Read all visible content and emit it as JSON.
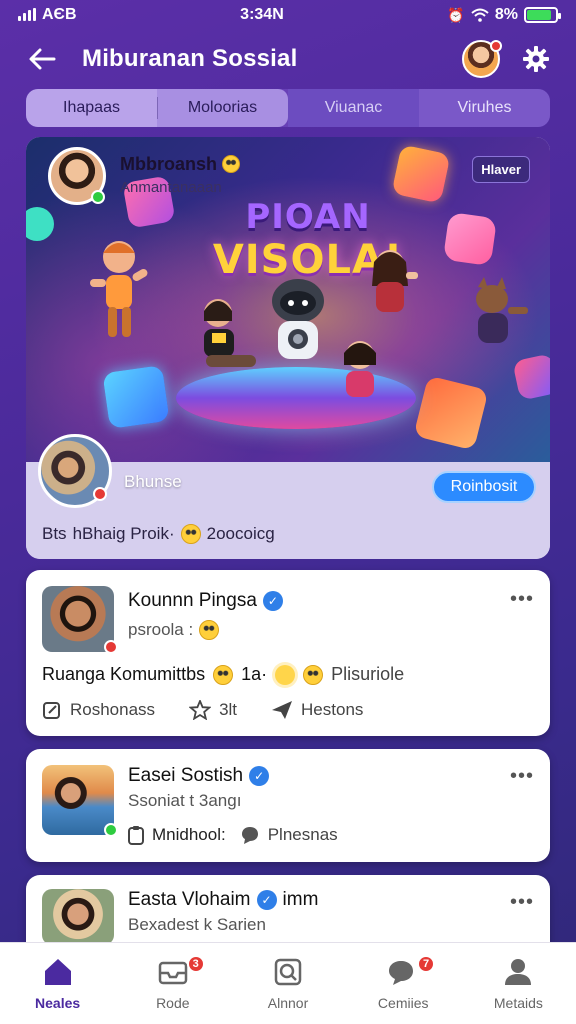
{
  "status_bar": {
    "carrier": "AЄB",
    "time": "3:34N",
    "battery": "8%",
    "battery_fraction": 0.85
  },
  "header": {
    "title": "Miburanan Sossial"
  },
  "tabs": [
    {
      "label": "Ihapaas"
    },
    {
      "label": "Moloorias"
    },
    {
      "label": "Viuanac"
    },
    {
      "label": "Viruhes"
    }
  ],
  "feature": {
    "author_name": "Mbbroansh",
    "author_sub": "Anmantanaaan",
    "tag": "Hlaver",
    "banner_line1": "PIOAN",
    "banner_line2": "VISOLA!",
    "group_name": "Bhunse",
    "join_label": "Roinbosit",
    "meta_left": "Bts",
    "meta_mid": "hBhaig Proik·",
    "meta_right": "2oocoicg"
  },
  "posts": [
    {
      "name": "Kounnn Pingsa",
      "sub": "psroola :",
      "line_text": "Ruanga Komumittbs",
      "line_extra": "1a·",
      "line_tail": "Plisuriole",
      "actions": {
        "share": "Roshonass",
        "stars": "3lt",
        "likes": "Hestons"
      }
    },
    {
      "name": "Easei Sostish",
      "sub": "Ssoniat t 3angı",
      "action_label": "Mnidhool:",
      "action_tail": "Plnesnas"
    },
    {
      "name": "Easta Vlohaim",
      "name_tail": "imm",
      "sub": "Bexadest k Sarien"
    }
  ],
  "nav": [
    {
      "label": "Neales",
      "icon": "home-icon"
    },
    {
      "label": "Rode",
      "icon": "inbox-icon",
      "badge": "3"
    },
    {
      "label": "Alnnor",
      "icon": "search-icon"
    },
    {
      "label": "Cemiies",
      "icon": "chat-icon",
      "badge": "7"
    },
    {
      "label": "Metaids",
      "icon": "profile-icon"
    }
  ]
}
